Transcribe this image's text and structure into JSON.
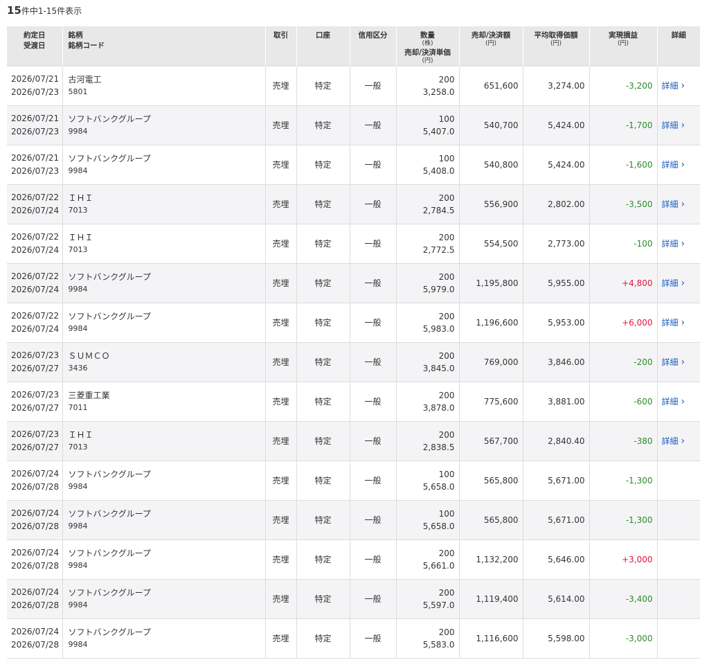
{
  "summary": {
    "count": "15",
    "text": "件中1-15件表示"
  },
  "headers": {
    "date1": "約定日",
    "date2": "受渡日",
    "name1": "銘柄",
    "name2": "銘柄コード",
    "trade": "取引",
    "account": "口座",
    "credit": "信用区分",
    "qty1": "数量",
    "qty_unit": "(株)",
    "qty2": "売却/決済単価",
    "qty2_unit": "(円)",
    "amount": "売却/決済額",
    "amount_unit": "(円)",
    "avg": "平均取得価額",
    "avg_unit": "(円)",
    "pl": "実現損益",
    "pl_unit": "(円)",
    "detail": "詳細"
  },
  "detail_label": "詳細",
  "rows": [
    {
      "trade_date": "2026/07/21",
      "settle_date": "2026/07/23",
      "name": "古河電工",
      "code": "5801",
      "trade": "売埋",
      "account": "特定",
      "credit": "一般",
      "qty": "200",
      "price": "3,258.0",
      "amount": "651,600",
      "avg": "3,274.00",
      "pl": "-3,200",
      "pl_sign": "neg",
      "has_detail": true
    },
    {
      "trade_date": "2026/07/21",
      "settle_date": "2026/07/23",
      "name": "ソフトバンクグループ",
      "code": "9984",
      "trade": "売埋",
      "account": "特定",
      "credit": "一般",
      "qty": "100",
      "price": "5,407.0",
      "amount": "540,700",
      "avg": "5,424.00",
      "pl": "-1,700",
      "pl_sign": "neg",
      "has_detail": true
    },
    {
      "trade_date": "2026/07/21",
      "settle_date": "2026/07/23",
      "name": "ソフトバンクグループ",
      "code": "9984",
      "trade": "売埋",
      "account": "特定",
      "credit": "一般",
      "qty": "100",
      "price": "5,408.0",
      "amount": "540,800",
      "avg": "5,424.00",
      "pl": "-1,600",
      "pl_sign": "neg",
      "has_detail": true
    },
    {
      "trade_date": "2026/07/22",
      "settle_date": "2026/07/24",
      "name": "ＩＨＩ",
      "code": "7013",
      "trade": "売埋",
      "account": "特定",
      "credit": "一般",
      "qty": "200",
      "price": "2,784.5",
      "amount": "556,900",
      "avg": "2,802.00",
      "pl": "-3,500",
      "pl_sign": "neg",
      "has_detail": true
    },
    {
      "trade_date": "2026/07/22",
      "settle_date": "2026/07/24",
      "name": "ＩＨＩ",
      "code": "7013",
      "trade": "売埋",
      "account": "特定",
      "credit": "一般",
      "qty": "200",
      "price": "2,772.5",
      "amount": "554,500",
      "avg": "2,773.00",
      "pl": "-100",
      "pl_sign": "neg",
      "has_detail": true
    },
    {
      "trade_date": "2026/07/22",
      "settle_date": "2026/07/24",
      "name": "ソフトバンクグループ",
      "code": "9984",
      "trade": "売埋",
      "account": "特定",
      "credit": "一般",
      "qty": "200",
      "price": "5,979.0",
      "amount": "1,195,800",
      "avg": "5,955.00",
      "pl": "+4,800",
      "pl_sign": "pos",
      "has_detail": true
    },
    {
      "trade_date": "2026/07/22",
      "settle_date": "2026/07/24",
      "name": "ソフトバンクグループ",
      "code": "9984",
      "trade": "売埋",
      "account": "特定",
      "credit": "一般",
      "qty": "200",
      "price": "5,983.0",
      "amount": "1,196,600",
      "avg": "5,953.00",
      "pl": "+6,000",
      "pl_sign": "pos",
      "has_detail": true
    },
    {
      "trade_date": "2026/07/23",
      "settle_date": "2026/07/27",
      "name": "ＳＵＭＣＯ",
      "code": "3436",
      "trade": "売埋",
      "account": "特定",
      "credit": "一般",
      "qty": "200",
      "price": "3,845.0",
      "amount": "769,000",
      "avg": "3,846.00",
      "pl": "-200",
      "pl_sign": "neg",
      "has_detail": true
    },
    {
      "trade_date": "2026/07/23",
      "settle_date": "2026/07/27",
      "name": "三菱重工業",
      "code": "7011",
      "trade": "売埋",
      "account": "特定",
      "credit": "一般",
      "qty": "200",
      "price": "3,878.0",
      "amount": "775,600",
      "avg": "3,881.00",
      "pl": "-600",
      "pl_sign": "neg",
      "has_detail": true
    },
    {
      "trade_date": "2026/07/23",
      "settle_date": "2026/07/27",
      "name": "ＩＨＩ",
      "code": "7013",
      "trade": "売埋",
      "account": "特定",
      "credit": "一般",
      "qty": "200",
      "price": "2,838.5",
      "amount": "567,700",
      "avg": "2,840.40",
      "pl": "-380",
      "pl_sign": "neg",
      "has_detail": true
    },
    {
      "trade_date": "2026/07/24",
      "settle_date": "2026/07/28",
      "name": "ソフトバンクグループ",
      "code": "9984",
      "trade": "売埋",
      "account": "特定",
      "credit": "一般",
      "qty": "100",
      "price": "5,658.0",
      "amount": "565,800",
      "avg": "5,671.00",
      "pl": "-1,300",
      "pl_sign": "neg",
      "has_detail": false
    },
    {
      "trade_date": "2026/07/24",
      "settle_date": "2026/07/28",
      "name": "ソフトバンクグループ",
      "code": "9984",
      "trade": "売埋",
      "account": "特定",
      "credit": "一般",
      "qty": "100",
      "price": "5,658.0",
      "amount": "565,800",
      "avg": "5,671.00",
      "pl": "-1,300",
      "pl_sign": "neg",
      "has_detail": false
    },
    {
      "trade_date": "2026/07/24",
      "settle_date": "2026/07/28",
      "name": "ソフトバンクグループ",
      "code": "9984",
      "trade": "売埋",
      "account": "特定",
      "credit": "一般",
      "qty": "200",
      "price": "5,661.0",
      "amount": "1,132,200",
      "avg": "5,646.00",
      "pl": "+3,000",
      "pl_sign": "pos",
      "has_detail": false
    },
    {
      "trade_date": "2026/07/24",
      "settle_date": "2026/07/28",
      "name": "ソフトバンクグループ",
      "code": "9984",
      "trade": "売埋",
      "account": "特定",
      "credit": "一般",
      "qty": "200",
      "price": "5,597.0",
      "amount": "1,119,400",
      "avg": "5,614.00",
      "pl": "-3,400",
      "pl_sign": "neg",
      "has_detail": false
    },
    {
      "trade_date": "2026/07/24",
      "settle_date": "2026/07/28",
      "name": "ソフトバンクグループ",
      "code": "9984",
      "trade": "売埋",
      "account": "特定",
      "credit": "一般",
      "qty": "200",
      "price": "5,583.0",
      "amount": "1,116,600",
      "avg": "5,598.00",
      "pl": "-3,000",
      "pl_sign": "neg",
      "has_detail": false
    }
  ]
}
